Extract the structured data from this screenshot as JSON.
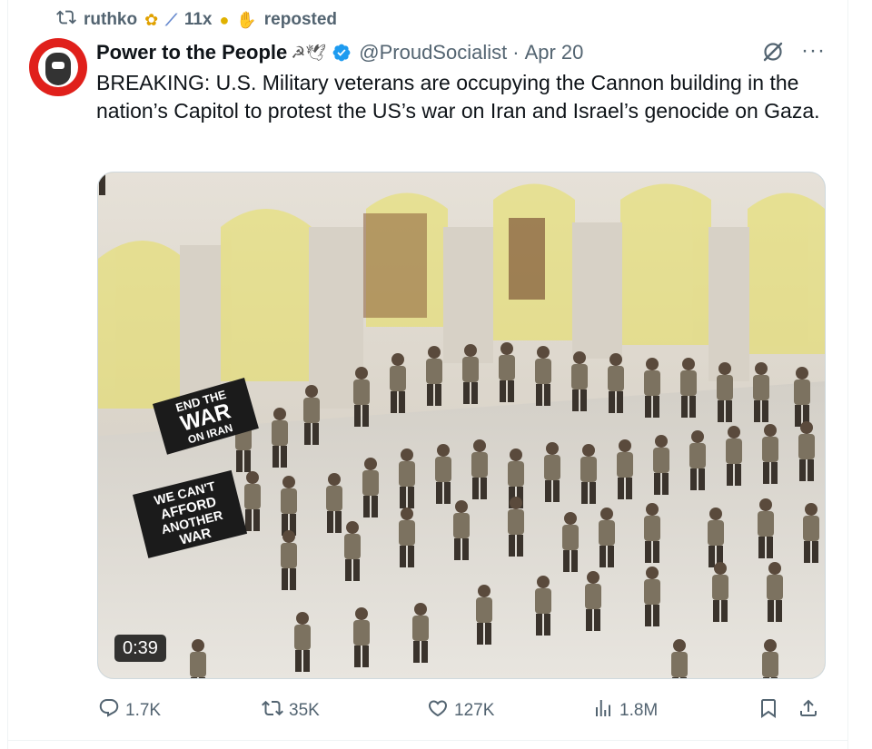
{
  "repost": {
    "user": "ruthko",
    "emojis": [
      "sunflower",
      "syringe",
      "mask-face",
      "hand"
    ],
    "count_label": "11x",
    "label": "reposted"
  },
  "post": {
    "display_name": "Power to the People",
    "name_emojis": "☭🕊",
    "handle": "@ProudSocialist",
    "separator": "·",
    "date": "Apr 20",
    "text": "BREAKING: U.S. Military veterans are occupying the Cannon building in the nation’s Capitol to protest the US’s war on Iran and Israel’s genocide on Gaza."
  },
  "media": {
    "duration": "0:39",
    "banner_1": [
      "END THE",
      "WAR",
      "ON IRAN"
    ],
    "banner_2": [
      "WE CAN'T",
      "AFFORD",
      "ANOTHER",
      "WAR"
    ]
  },
  "actions": {
    "replies": "1.7K",
    "reposts": "35K",
    "likes": "127K",
    "views": "1.8M"
  },
  "colors": {
    "accent_verified": "#1d9bf0",
    "muted": "#536471",
    "avatar_bg": "#e0201b"
  }
}
